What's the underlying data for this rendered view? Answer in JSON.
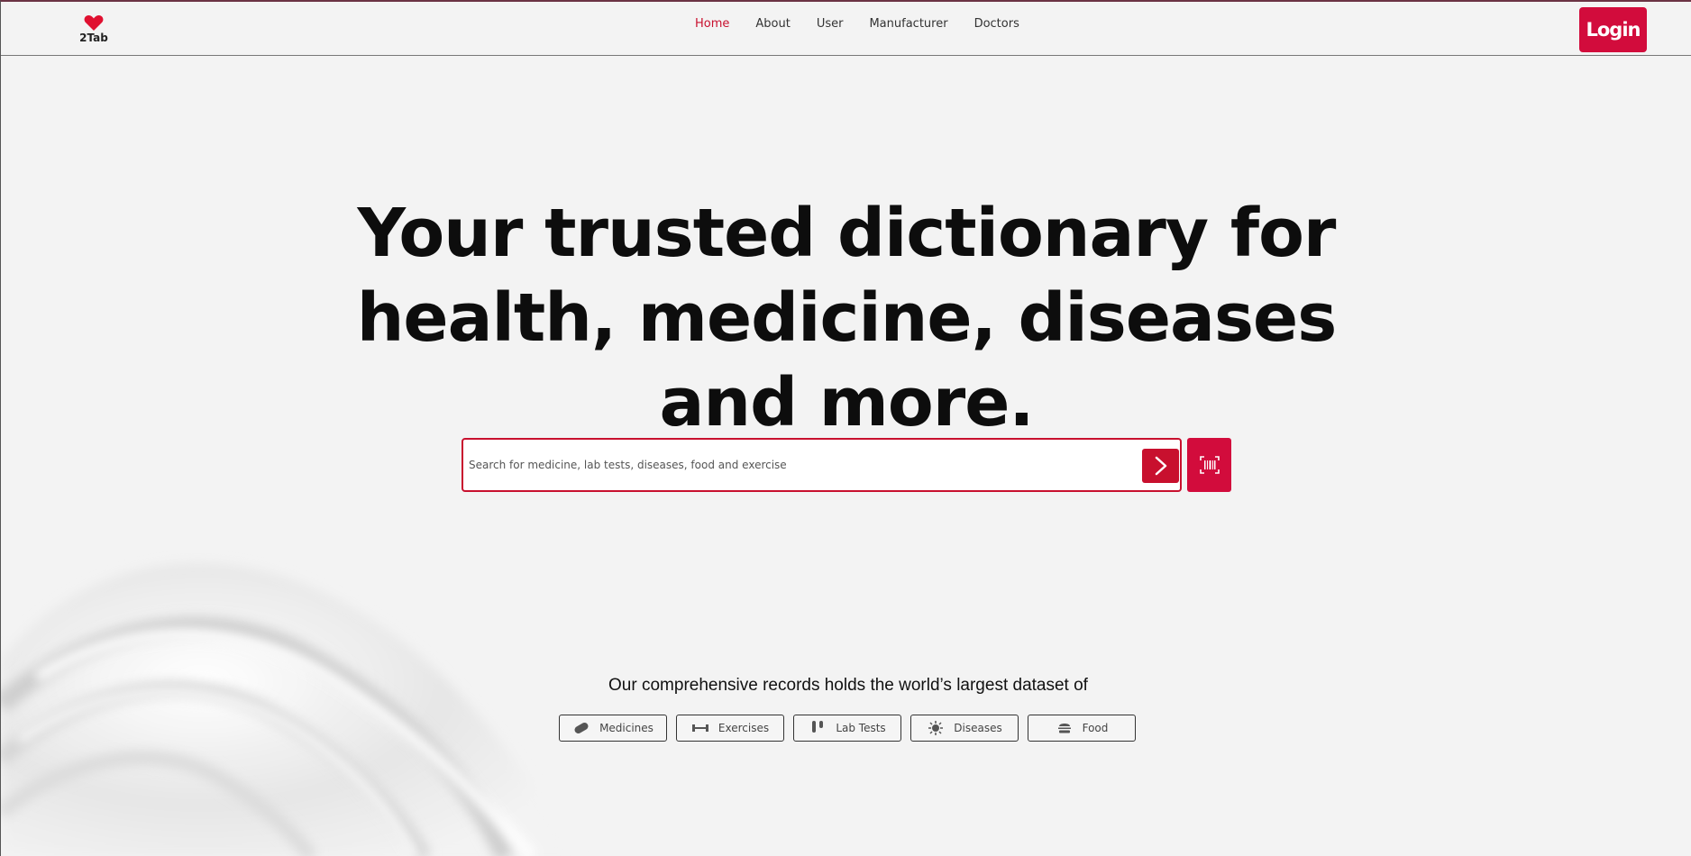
{
  "header": {
    "logo_text": "2Tab",
    "nav": [
      {
        "label": "Home",
        "active": true
      },
      {
        "label": "About",
        "active": false
      },
      {
        "label": "User",
        "active": false
      },
      {
        "label": "Manufacturer",
        "active": false
      },
      {
        "label": "Doctors",
        "active": false
      }
    ],
    "login_label": "Login"
  },
  "hero": {
    "title": "Your trusted dictionary for health, medicine, diseases and more."
  },
  "search": {
    "placeholder": "Search for medicine, lab tests, diseases, food and exercise",
    "value": ""
  },
  "dataset": {
    "title": "Our comprehensive records holds the world’s largest dataset of",
    "categories": [
      {
        "label": "Medicines",
        "icon": "pill-icon"
      },
      {
        "label": "Exercises",
        "icon": "dumbbell-icon"
      },
      {
        "label": "Lab Tests",
        "icon": "test-tube-icon"
      },
      {
        "label": "Diseases",
        "icon": "virus-icon"
      },
      {
        "label": "Food",
        "icon": "burger-icon"
      }
    ]
  },
  "colors": {
    "accent": "#c8102e",
    "background": "#f3f3f3"
  }
}
